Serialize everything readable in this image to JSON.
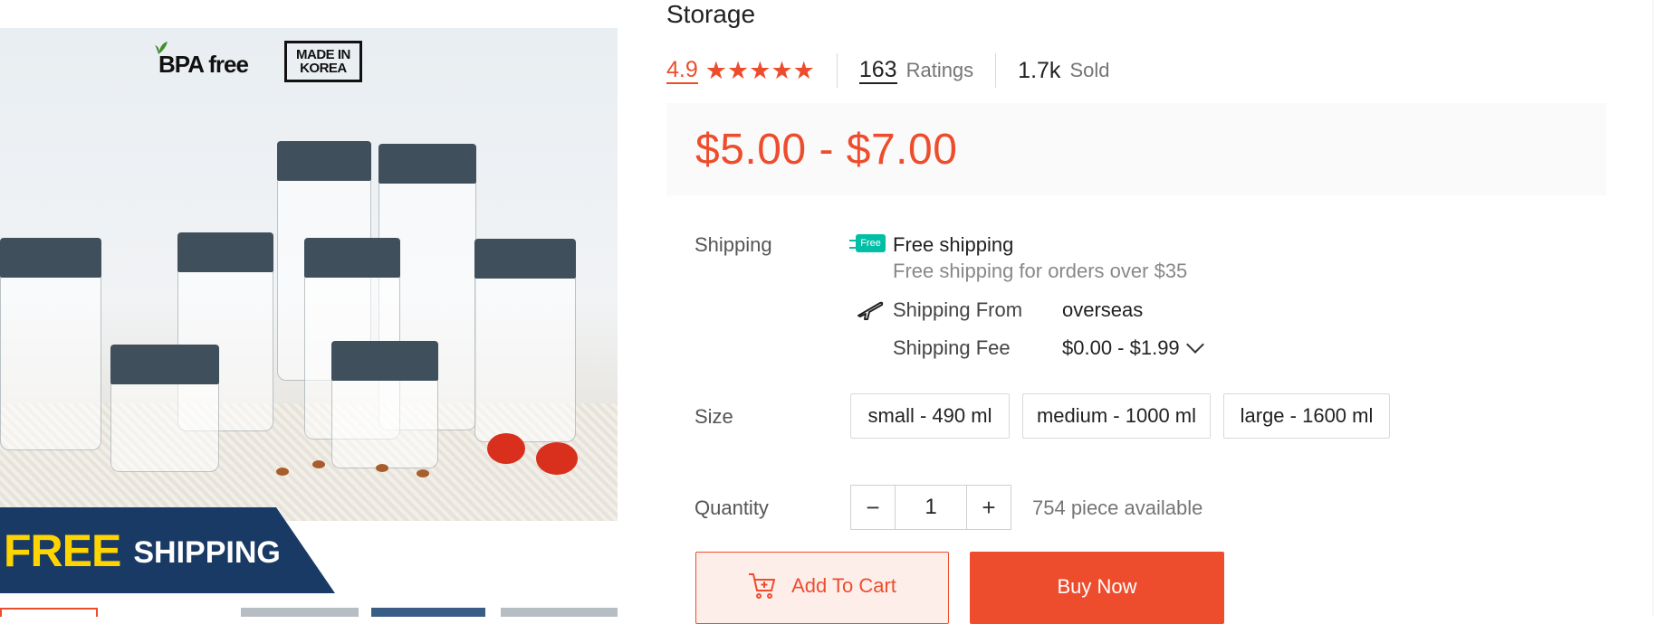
{
  "product": {
    "title": "Storage",
    "image_badges": {
      "bpa": "BPA free",
      "made_in_line1": "MADE IN",
      "made_in_line2": "KOREA"
    },
    "banner": {
      "free": "FREE",
      "shipping": "SHIPPING"
    }
  },
  "rating": {
    "score": "4.9",
    "stars": 5,
    "count": "163",
    "count_label": "Ratings",
    "sold": "1.7k",
    "sold_label": "Sold"
  },
  "price": {
    "range": "$5.00 - $7.00"
  },
  "shipping": {
    "label": "Shipping",
    "free_badge": "Free",
    "free_title": "Free shipping",
    "free_note": "Free shipping for orders over $35",
    "from_label": "Shipping From",
    "from_value": "overseas",
    "fee_label": "Shipping Fee",
    "fee_value": "$0.00 - $1.99"
  },
  "size": {
    "label": "Size",
    "options": [
      "small - 490 ml",
      "medium - 1000 ml",
      "large - 1600 ml"
    ]
  },
  "quantity": {
    "label": "Quantity",
    "value": "1",
    "minus": "−",
    "plus": "+",
    "available": "754 piece available"
  },
  "actions": {
    "add_to_cart": "Add To Cart",
    "buy_now": "Buy Now"
  },
  "colors": {
    "accent": "#ee4d2d",
    "free_badge": "#00bfa5",
    "banner": "#193a64",
    "banner_free": "#ffd400",
    "jar_lid": "#3f4f5b"
  }
}
